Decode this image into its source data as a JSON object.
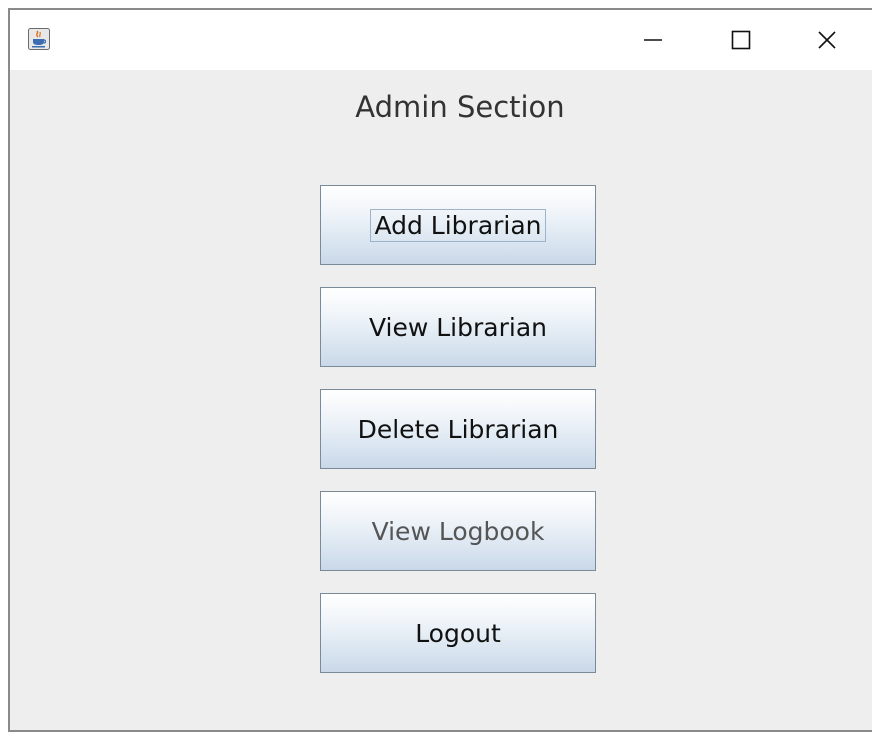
{
  "window": {
    "app_icon": "java-coffee-cup-icon",
    "controls": [
      "minimize-icon",
      "maximize-icon",
      "close-icon"
    ]
  },
  "heading": "Admin Section",
  "buttons": {
    "add_librarian": "Add Librarian",
    "view_librarian": "View Librarian",
    "delete_librarian": "Delete Librarian",
    "view_logbook": "View Logbook",
    "logout": "Logout"
  }
}
